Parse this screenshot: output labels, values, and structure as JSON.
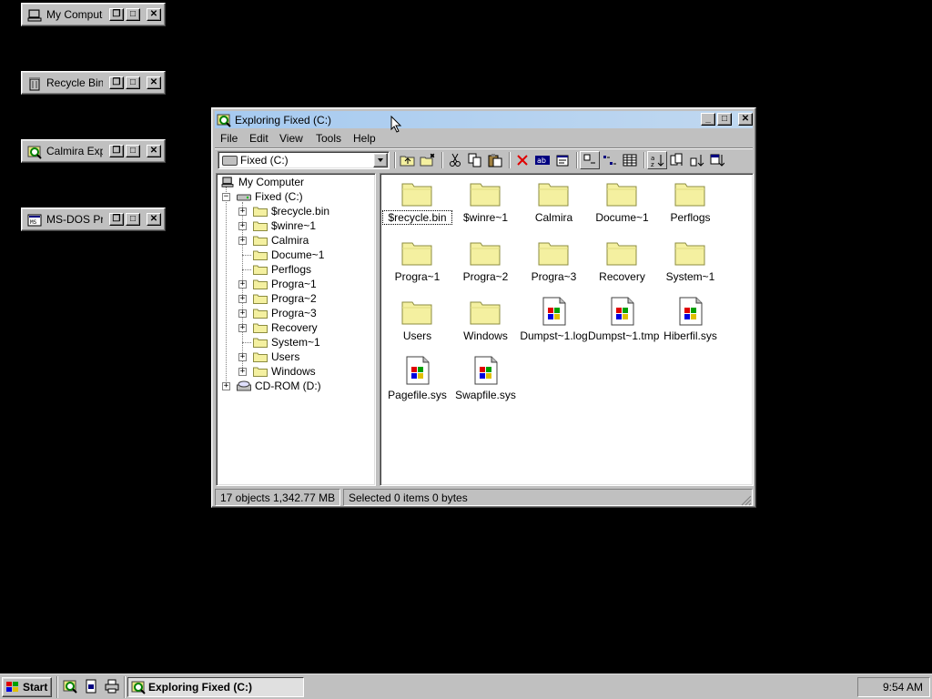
{
  "desktop": {
    "minimized": [
      {
        "label": "My Computer",
        "icon": "computer-icon"
      },
      {
        "label": "Recycle Bin",
        "icon": "recycle-bin-icon"
      },
      {
        "label": "Calmira Explorer",
        "icon": "explorer-icon"
      },
      {
        "label": "MS-DOS Prompt",
        "icon": "msdos-icon"
      }
    ]
  },
  "window": {
    "title": "Exploring Fixed (C:)",
    "menu": [
      "File",
      "Edit",
      "View",
      "Tools",
      "Help"
    ],
    "drive_select": "Fixed (C:)",
    "tree": {
      "root": "My Computer",
      "drive": "Fixed (C:)",
      "folders": [
        {
          "name": "$recycle.bin",
          "expandable": true
        },
        {
          "name": "$winre~1",
          "expandable": true
        },
        {
          "name": "Calmira",
          "expandable": true
        },
        {
          "name": "Docume~1",
          "expandable": false
        },
        {
          "name": "Perflogs",
          "expandable": false
        },
        {
          "name": "Progra~1",
          "expandable": true
        },
        {
          "name": "Progra~2",
          "expandable": true
        },
        {
          "name": "Progra~3",
          "expandable": true
        },
        {
          "name": "Recovery",
          "expandable": true
        },
        {
          "name": "System~1",
          "expandable": false
        },
        {
          "name": "Users",
          "expandable": true
        },
        {
          "name": "Windows",
          "expandable": true
        }
      ],
      "cdrom": "CD-ROM (D:)"
    },
    "items": [
      {
        "name": "$recycle.bin",
        "type": "folder",
        "selected": true
      },
      {
        "name": "$winre~1",
        "type": "folder"
      },
      {
        "name": "Calmira",
        "type": "folder"
      },
      {
        "name": "Docume~1",
        "type": "folder"
      },
      {
        "name": "Perflogs",
        "type": "folder"
      },
      {
        "name": "Progra~1",
        "type": "folder"
      },
      {
        "name": "Progra~2",
        "type": "folder"
      },
      {
        "name": "Progra~3",
        "type": "folder"
      },
      {
        "name": "Recovery",
        "type": "folder"
      },
      {
        "name": "System~1",
        "type": "folder"
      },
      {
        "name": "Users",
        "type": "folder"
      },
      {
        "name": "Windows",
        "type": "folder"
      },
      {
        "name": "Dumpst~1.log",
        "type": "file"
      },
      {
        "name": "Dumpst~1.tmp",
        "type": "file"
      },
      {
        "name": "Hiberfil.sys",
        "type": "file"
      },
      {
        "name": "Pagefile.sys",
        "type": "file"
      },
      {
        "name": "Swapfile.sys",
        "type": "file"
      }
    ],
    "status": {
      "objects": "17 objects  1,342.77 MB",
      "selected": "Selected 0 items  0 bytes"
    }
  },
  "taskbar": {
    "start": "Start",
    "task": "Exploring Fixed (C:)",
    "clock": "9:54 AM"
  },
  "colors": {
    "folder": "#f4f0a0",
    "folder_edge": "#8c8c40",
    "face": "#c0c0c0",
    "title": "#a6caf0"
  }
}
